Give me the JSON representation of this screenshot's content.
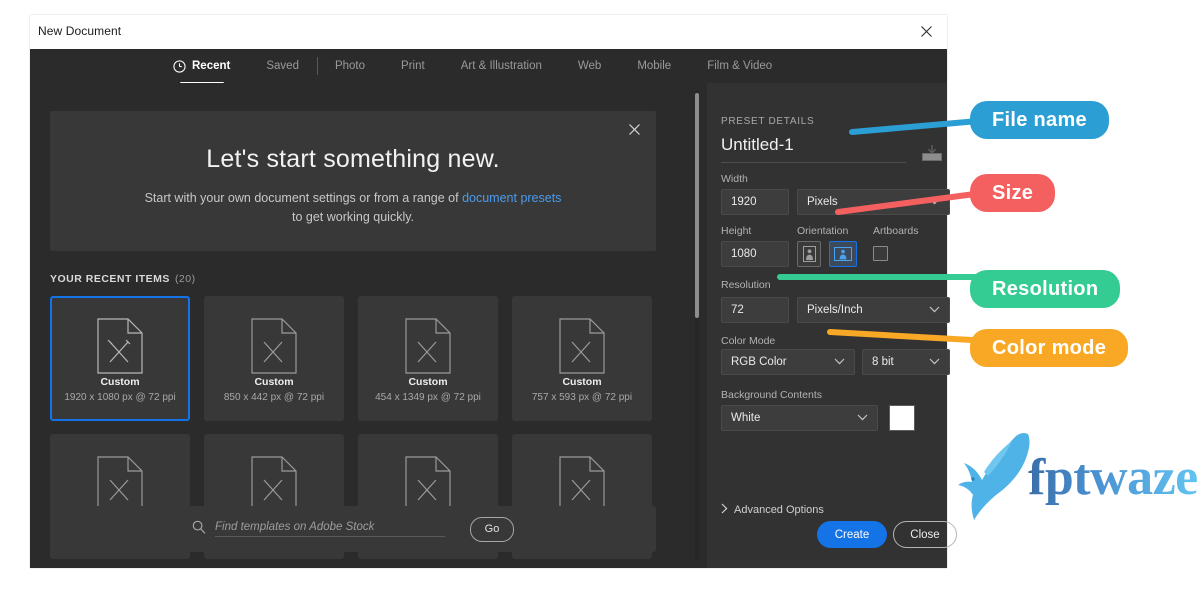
{
  "window": {
    "title": "New Document",
    "close_icon": "close-icon"
  },
  "tabs": [
    {
      "label": "Recent",
      "icon": "clock-icon",
      "active": true
    },
    {
      "label": "Saved",
      "active": false
    },
    {
      "label": "Photo",
      "active": false
    },
    {
      "label": "Print",
      "active": false
    },
    {
      "label": "Art & Illustration",
      "active": false
    },
    {
      "label": "Web",
      "active": false
    },
    {
      "label": "Mobile",
      "active": false
    },
    {
      "label": "Film & Video",
      "active": false
    }
  ],
  "banner": {
    "headline": "Let's start something new.",
    "line1_before": "Start with your own document settings or from a range of ",
    "link": "document presets",
    "line2": "to get working quickly.",
    "close_icon": "close-icon"
  },
  "recent": {
    "heading": "YOUR RECENT ITEMS",
    "count": "(20)",
    "items": [
      {
        "name": "Custom",
        "dimensions": "1920 x 1080 px @ 72 ppi",
        "selected": true
      },
      {
        "name": "Custom",
        "dimensions": "850 x 442 px @ 72 ppi",
        "selected": false
      },
      {
        "name": "Custom",
        "dimensions": "454 x 1349 px @ 72 ppi",
        "selected": false
      },
      {
        "name": "Custom",
        "dimensions": "757 x 593 px @ 72 ppi",
        "selected": false
      }
    ]
  },
  "search": {
    "placeholder": "Find templates on Adobe Stock",
    "go_label": "Go",
    "icon": "search-icon"
  },
  "preset_details": {
    "section_title": "PRESET DETAILS",
    "file_name": "Untitled-1",
    "save_preset_icon": "save-preset-icon",
    "width_label": "Width",
    "width_value": "1920",
    "width_unit": "Pixels",
    "height_label": "Height",
    "height_value": "1080",
    "orientation_label": "Orientation",
    "orientation_portrait_icon": "portrait-orientation-icon",
    "orientation_landscape_icon": "landscape-orientation-icon",
    "artboards_label": "Artboards",
    "artboards_checked": false,
    "resolution_label": "Resolution",
    "resolution_value": "72",
    "resolution_unit": "Pixels/Inch",
    "color_mode_label": "Color Mode",
    "color_mode_value": "RGB Color",
    "color_depth_value": "8 bit",
    "background_label": "Background Contents",
    "background_value": "White",
    "background_swatch_hex": "#ffffff",
    "advanced_label": "Advanced Options"
  },
  "actions": {
    "create_label": "Create",
    "close_label": "Close"
  },
  "annotations": [
    {
      "label": "File name",
      "color": "#2b9ed4"
    },
    {
      "label": "Size",
      "color": "#f4605f"
    },
    {
      "label": "Resolution",
      "color": "#35cc94"
    },
    {
      "label": "Color mode",
      "color": "#f9a826"
    }
  ],
  "logo": {
    "text": "fptwaze",
    "bird_icon": "bird-logo-icon",
    "color": "#4fb3e8"
  },
  "accent": {
    "blue": "#1473e6",
    "link": "#4a9bec",
    "panel_bg": "#323232",
    "left_bg": "#2b2b2b",
    "card_bg": "#383838"
  }
}
